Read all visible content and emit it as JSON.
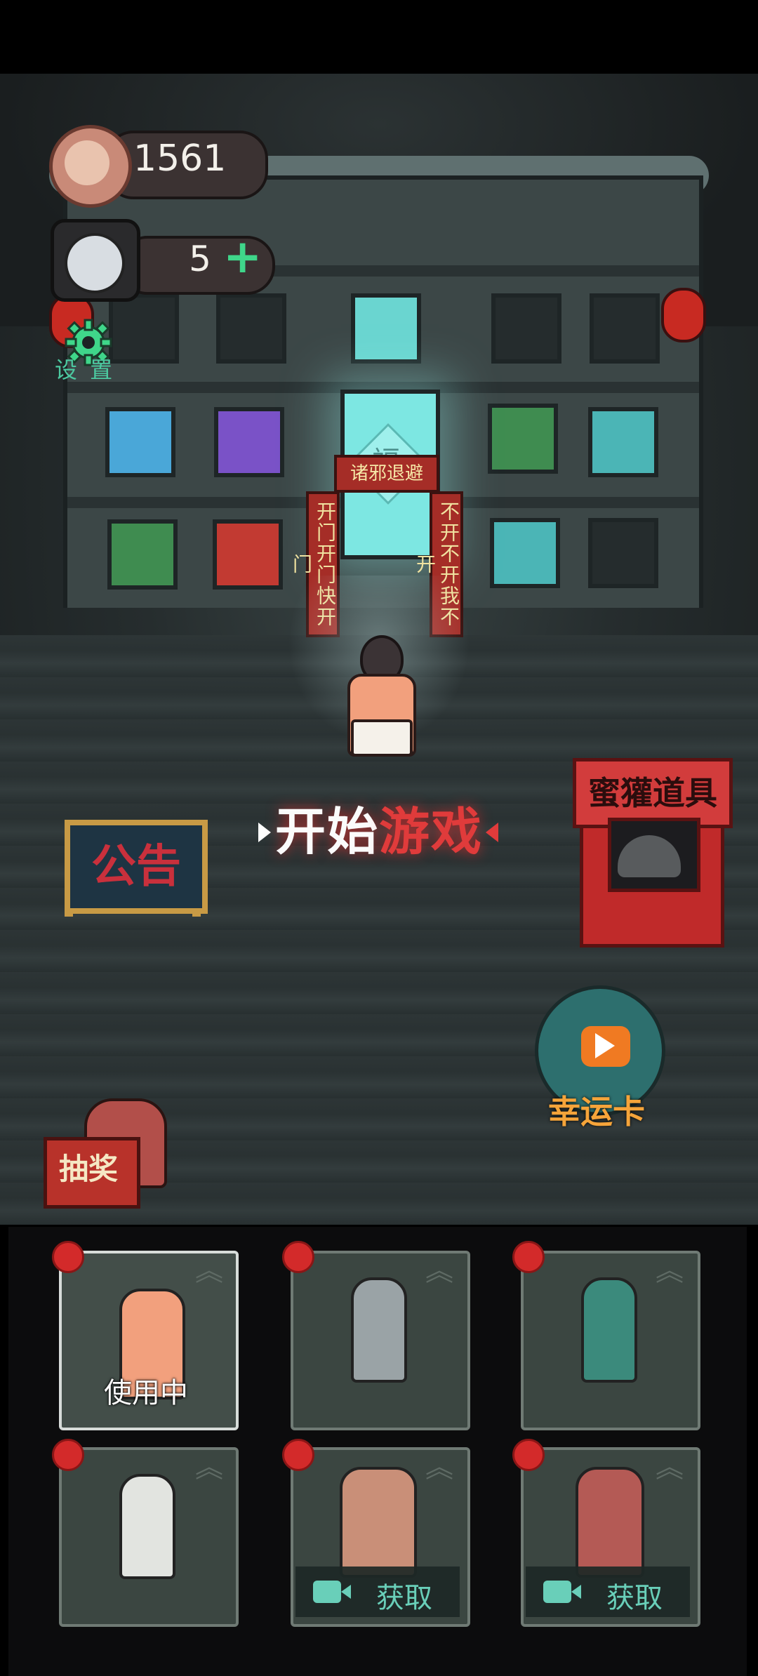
{
  "hud": {
    "coins": "1561",
    "tokens": "5",
    "settings_label": "设 置"
  },
  "scene": {
    "door_lintel": "诸邪退避",
    "couplet_left": "开门开门快开门",
    "couplet_right": "不开不开我不开",
    "door_fu": "福"
  },
  "menu": {
    "notice_label": "公告",
    "start_white": "开始",
    "start_red": "游戏",
    "shop_label": "蜜獾道具",
    "lucky_card_label": "幸运卡",
    "draw_label": "抽奖"
  },
  "characters": [
    {
      "status": "使用中",
      "active": true,
      "locked": false,
      "obtain_label": ""
    },
    {
      "status": "",
      "active": false,
      "locked": false,
      "obtain_label": ""
    },
    {
      "status": "",
      "active": false,
      "locked": false,
      "obtain_label": ""
    },
    {
      "status": "",
      "active": false,
      "locked": false,
      "obtain_label": ""
    },
    {
      "status": "",
      "active": false,
      "locked": true,
      "obtain_label": "获取"
    },
    {
      "status": "",
      "active": false,
      "locked": true,
      "obtain_label": "获取"
    }
  ],
  "colors": {
    "accent_green": "#3fd68a",
    "red_notice": "#c9303c",
    "gold_frame": "#c89a45",
    "lucky_orange": "#f5a43a",
    "obtain_teal": "#69cfb9"
  }
}
